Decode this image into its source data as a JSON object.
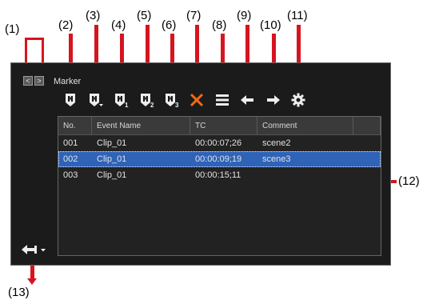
{
  "callouts": [
    "(1)",
    "(2)",
    "(3)",
    "(4)",
    "(5)",
    "(6)",
    "(7)",
    "(8)",
    "(9)",
    "(10)",
    "(11)",
    "(12)",
    "(13)"
  ],
  "panel": {
    "nav_prev": "<",
    "nav_next": ">",
    "title": "Marker"
  },
  "toolbar": {
    "icons": [
      "marker-icon",
      "marker-dropdown-icon",
      "marker-1-icon",
      "marker-2-icon",
      "marker-3-icon",
      "delete-icon",
      "list-icon",
      "left-arrow-icon",
      "right-arrow-icon",
      "settings-icon"
    ],
    "sub_labels": {
      "marker_1": "1",
      "marker_2": "2",
      "marker_3": "3"
    }
  },
  "table": {
    "headers": [
      "No.",
      "Event Name",
      "TC",
      "Comment",
      ""
    ],
    "rows": [
      {
        "no": "001",
        "event": "Clip_01",
        "tc": "00:00:07;26",
        "comment": "scene2",
        "selected": false
      },
      {
        "no": "002",
        "event": "Clip_01",
        "tc": "00:00:09;19",
        "comment": "scene3",
        "selected": true
      },
      {
        "no": "003",
        "event": "Clip_01",
        "tc": "00:00:15;11",
        "comment": "",
        "selected": false
      }
    ]
  },
  "colors": {
    "accent": "#d7141e",
    "selection": "#2f63b8",
    "panel_bg": "#1b1b1b"
  }
}
